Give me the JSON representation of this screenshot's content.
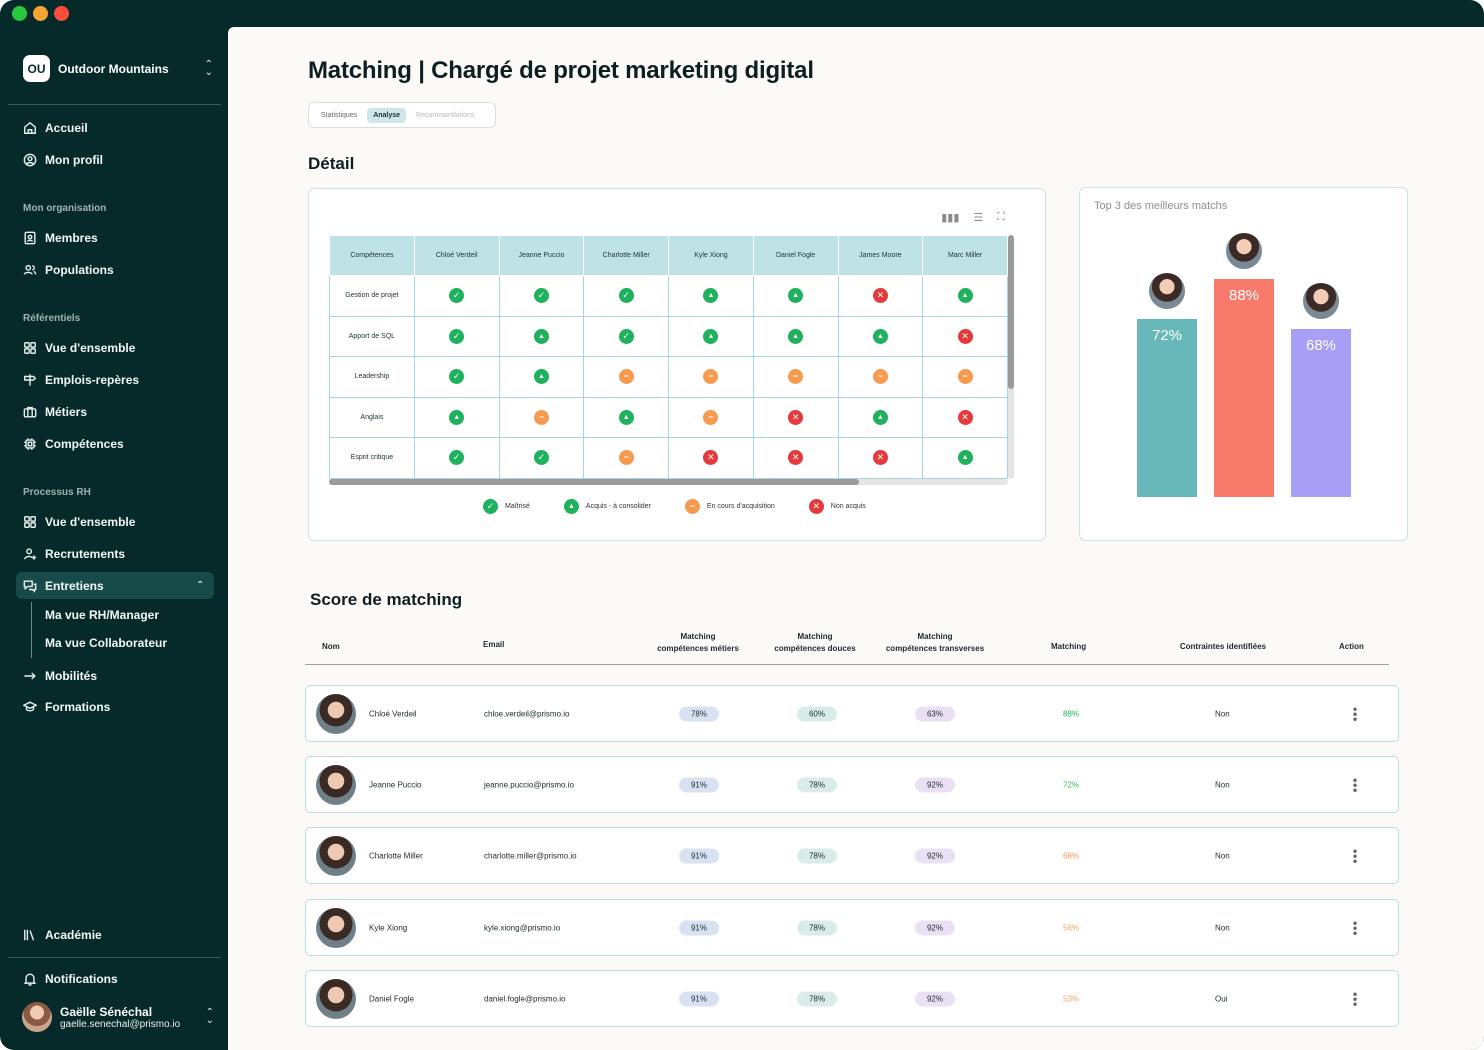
{
  "window": {
    "traffic_colors": [
      "#27c93f",
      "#f7a531",
      "#ff4c3b"
    ]
  },
  "sidebar": {
    "org_badge": "OU",
    "org_name": "Outdoor Mountains",
    "items_top": [
      {
        "label": "Accueil",
        "icon": "home-icon"
      },
      {
        "label": "Mon profil",
        "icon": "profile-icon"
      }
    ],
    "section_org": "Mon organisation",
    "items_org": [
      {
        "label": "Membres",
        "icon": "members-icon"
      },
      {
        "label": "Populations",
        "icon": "populations-icon"
      }
    ],
    "section_ref": "Référentiels",
    "items_ref": [
      {
        "label": "Vue d'ensemble",
        "icon": "grid-icon"
      },
      {
        "label": "Emplois-repères",
        "icon": "signpost-icon"
      },
      {
        "label": "Métiers",
        "icon": "briefcase-icon"
      },
      {
        "label": "Compétences",
        "icon": "chip-icon"
      }
    ],
    "section_rh": "Processus RH",
    "items_rh": [
      {
        "label": "Vue d'ensemble",
        "icon": "grid-icon"
      },
      {
        "label": "Recrutements",
        "icon": "user-plus-icon"
      },
      {
        "label": "Entretiens",
        "icon": "chat-icon"
      }
    ],
    "sub_items": [
      "Ma vue RH/Manager",
      "Ma vue Collaborateur"
    ],
    "items_after": [
      {
        "label": "Mobilités",
        "icon": "arrow-right-icon"
      },
      {
        "label": "Formations",
        "icon": "graduation-icon"
      }
    ],
    "academy": "Académie",
    "notifications": "Notifications",
    "user_name": "Gaëlle Sénéchal",
    "user_email": "gaelle.senechal@prismo.io"
  },
  "header": {
    "title": "Matching | Chargé de projet marketing digital",
    "tabs": [
      "Statistiques",
      "Analyse",
      "Recommandations"
    ],
    "active_tab": "Analyse"
  },
  "detail": {
    "title": "Détail",
    "columns": [
      "Compétences",
      "Chloé Verdeil",
      "Jeanne Puccio",
      "Charlotte Miller",
      "Kyle Xiong",
      "Daniel Fogle",
      "James Moore",
      "Marc Miller"
    ],
    "rows": [
      {
        "skill": "Gestion de projet",
        "status": [
          "m",
          "m",
          "m",
          "a",
          "a",
          "n",
          "a"
        ]
      },
      {
        "skill": "Apport de SQL",
        "status": [
          "m",
          "a",
          "m",
          "a",
          "a",
          "a",
          "n"
        ]
      },
      {
        "skill": "Leadership",
        "status": [
          "m",
          "a",
          "c",
          "c",
          "c",
          "c",
          "c"
        ]
      },
      {
        "skill": "Anglais",
        "status": [
          "a",
          "c",
          "a",
          "c",
          "n",
          "a",
          "n"
        ]
      },
      {
        "skill": "Esprit critique",
        "status": [
          "m",
          "m",
          "c",
          "n",
          "n",
          "n",
          "a"
        ]
      }
    ],
    "legend": [
      {
        "key": "m",
        "label": "Maîtrisé"
      },
      {
        "key": "a",
        "label": "Acquis - à consolider"
      },
      {
        "key": "c",
        "label": "En cours d'acquisition"
      },
      {
        "key": "n",
        "label": "Non acquis"
      }
    ]
  },
  "top3": {
    "title": "Top 3 des meilleurs matchs",
    "bars": [
      {
        "label": "72%",
        "value": 72,
        "color": "#68b7b9"
      },
      {
        "label": "88%",
        "value": 88,
        "color": "#f87a6b"
      },
      {
        "label": "68%",
        "value": 68,
        "color": "#a89ef5"
      }
    ]
  },
  "score": {
    "title": "Score de matching",
    "headers": {
      "name": "Nom",
      "email": "Email",
      "metiers": [
        "Matching",
        "compétences métiers"
      ],
      "douces": [
        "Matching",
        "compétences douces"
      ],
      "transverses": [
        "Matching",
        "compétences transverses"
      ],
      "matching": "Matching",
      "contraintes": "Contraintes identifiées",
      "action": "Action"
    },
    "rows": [
      {
        "name": "Chloé Verdeil",
        "email": "chloe.verdeil@prismo.io",
        "metiers": "78%",
        "douces": "60%",
        "transverses": "63%",
        "matching": "88%",
        "matching_color": "#1fb15d",
        "contraintes": "Non"
      },
      {
        "name": "Jeanne Puccio",
        "email": "jeanne.puccio@prismo.io",
        "metiers": "91%",
        "douces": "78%",
        "transverses": "92%",
        "matching": "72%",
        "matching_color": "#32b95f",
        "contraintes": "Non"
      },
      {
        "name": "Charlotte Miller",
        "email": "charlotte.miller@prismo.io",
        "metiers": "91%",
        "douces": "78%",
        "transverses": "92%",
        "matching": "68%",
        "matching_color": "#f59a4f",
        "contraintes": "Non"
      },
      {
        "name": "Kyle Xiong",
        "email": "kyle.xiong@prismo.io",
        "metiers": "91%",
        "douces": "78%",
        "transverses": "92%",
        "matching": "56%",
        "matching_color": "#f5a65f",
        "contraintes": "Non"
      },
      {
        "name": "Daniel Fogle",
        "email": "daniel.fogle@prismo.io",
        "metiers": "91%",
        "douces": "78%",
        "transverses": "92%",
        "matching": "53%",
        "matching_color": "#f5a65f",
        "contraintes": "Oui"
      }
    ]
  }
}
